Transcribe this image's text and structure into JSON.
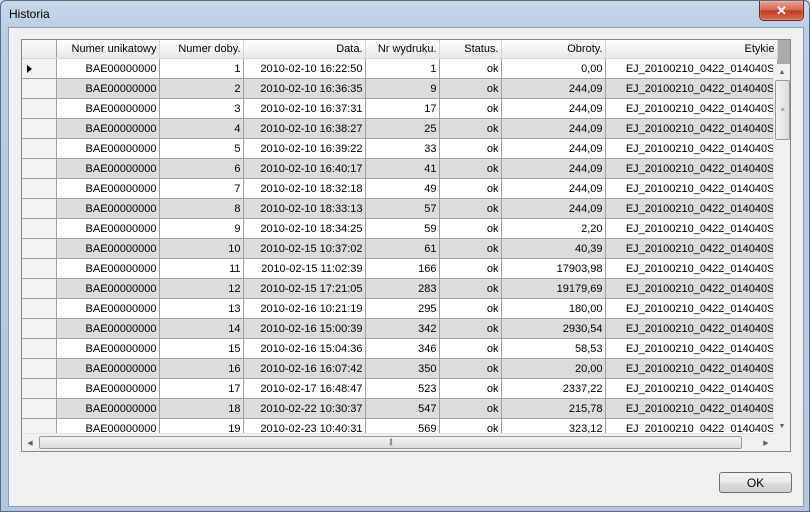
{
  "window": {
    "title": "Historia",
    "close_label": "✕"
  },
  "grid": {
    "columns": [
      "",
      "Numer unikatowy",
      "Numer doby.",
      "Data.",
      "Nr wydruku.",
      "Status.",
      "Obroty.",
      "Etykie"
    ],
    "rows": [
      [
        "BAE00000000",
        "1",
        "2010-02-10 16:22:50",
        "1",
        "ok",
        "0,00",
        "EJ_20100210_0422_014040S"
      ],
      [
        "BAE00000000",
        "2",
        "2010-02-10 16:36:35",
        "9",
        "ok",
        "244,09",
        "EJ_20100210_0422_014040S"
      ],
      [
        "BAE00000000",
        "3",
        "2010-02-10 16:37:31",
        "17",
        "ok",
        "244,09",
        "EJ_20100210_0422_014040S"
      ],
      [
        "BAE00000000",
        "4",
        "2010-02-10 16:38:27",
        "25",
        "ok",
        "244,09",
        "EJ_20100210_0422_014040S"
      ],
      [
        "BAE00000000",
        "5",
        "2010-02-10 16:39:22",
        "33",
        "ok",
        "244,09",
        "EJ_20100210_0422_014040S"
      ],
      [
        "BAE00000000",
        "6",
        "2010-02-10 16:40:17",
        "41",
        "ok",
        "244,09",
        "EJ_20100210_0422_014040S"
      ],
      [
        "BAE00000000",
        "7",
        "2010-02-10 18:32:18",
        "49",
        "ok",
        "244,09",
        "EJ_20100210_0422_014040S"
      ],
      [
        "BAE00000000",
        "8",
        "2010-02-10 18:33:13",
        "57",
        "ok",
        "244,09",
        "EJ_20100210_0422_014040S"
      ],
      [
        "BAE00000000",
        "9",
        "2010-02-10 18:34:25",
        "59",
        "ok",
        "2,20",
        "EJ_20100210_0422_014040S"
      ],
      [
        "BAE00000000",
        "10",
        "2010-02-15 10:37:02",
        "61",
        "ok",
        "40,39",
        "EJ_20100210_0422_014040S"
      ],
      [
        "BAE00000000",
        "11",
        "2010-02-15 11:02:39",
        "166",
        "ok",
        "17903,98",
        "EJ_20100210_0422_014040S"
      ],
      [
        "BAE00000000",
        "12",
        "2010-02-15 17:21:05",
        "283",
        "ok",
        "19179,69",
        "EJ_20100210_0422_014040S"
      ],
      [
        "BAE00000000",
        "13",
        "2010-02-16 10:21:19",
        "295",
        "ok",
        "180,00",
        "EJ_20100210_0422_014040S"
      ],
      [
        "BAE00000000",
        "14",
        "2010-02-16 15:00:39",
        "342",
        "ok",
        "2930,54",
        "EJ_20100210_0422_014040S"
      ],
      [
        "BAE00000000",
        "15",
        "2010-02-16 15:04:36",
        "346",
        "ok",
        "58,53",
        "EJ_20100210_0422_014040S"
      ],
      [
        "BAE00000000",
        "16",
        "2010-02-16 16:07:42",
        "350",
        "ok",
        "20,00",
        "EJ_20100210_0422_014040S"
      ],
      [
        "BAE00000000",
        "17",
        "2010-02-17 16:48:47",
        "523",
        "ok",
        "2337,22",
        "EJ_20100210_0422_014040S"
      ],
      [
        "BAE00000000",
        "18",
        "2010-02-22 10:30:37",
        "547",
        "ok",
        "215,78",
        "EJ_20100210_0422_014040S"
      ],
      [
        "BAE00000000",
        "19",
        "2010-02-23 10:40:31",
        "569",
        "ok",
        "323,12",
        "EJ_20100210_0422_014040S"
      ]
    ],
    "selected_row": 0
  },
  "buttons": {
    "ok_label": "OK"
  }
}
